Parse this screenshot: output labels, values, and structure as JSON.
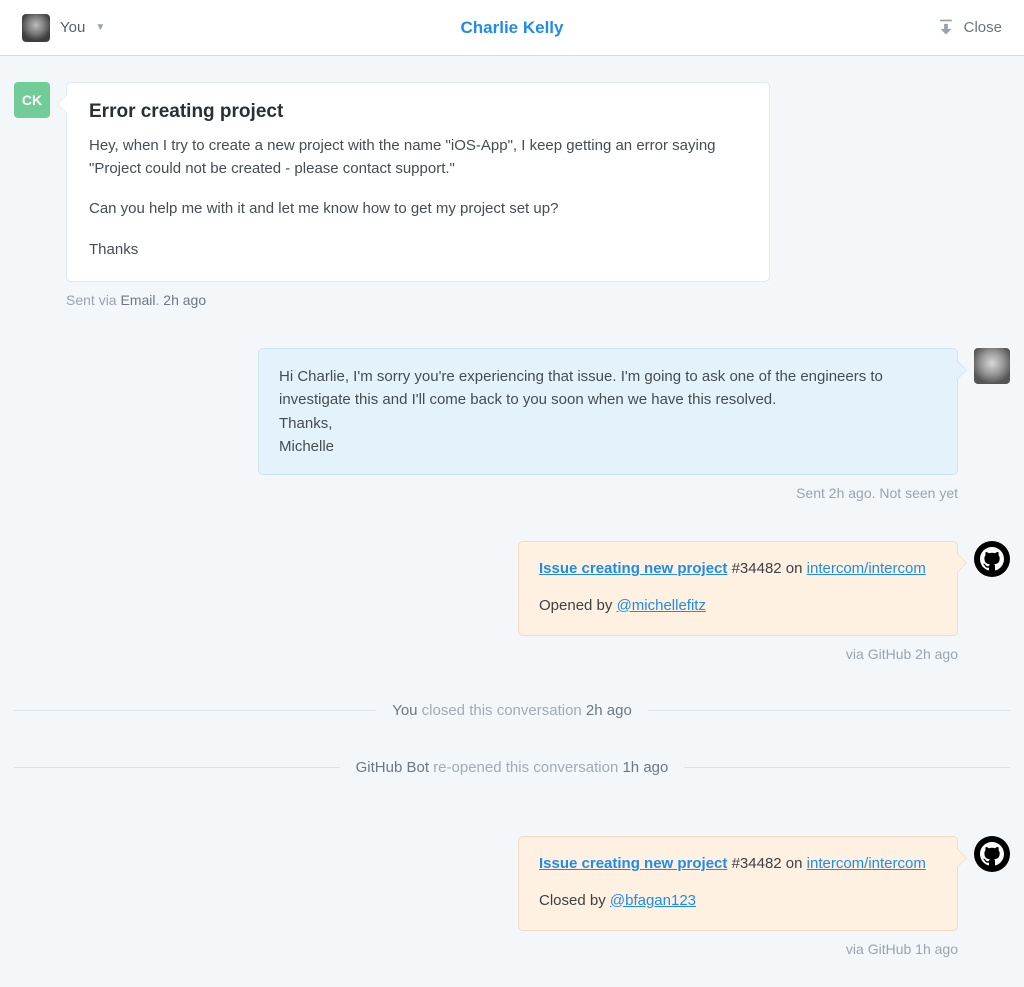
{
  "header": {
    "you_label": "You",
    "contact_name": "Charlie Kelly",
    "close_label": "Close"
  },
  "incoming": {
    "avatar_initials": "CK",
    "title": "Error creating project",
    "p1": "Hey, when I try to create a new project with the name \"iOS-App\", I keep getting an error saying \"Project could not be created - please contact support.\"",
    "p2": "Can you help me with it and let me know how to get my project set up?",
    "p3": "Thanks",
    "meta_prefix": "Sent via ",
    "meta_channel": "Email",
    "meta_sep": ". ",
    "meta_time": "2h ago"
  },
  "reply": {
    "line1": "Hi Charlie, I'm sorry you're experiencing that issue. I'm going to ask one of the engineers to investigate this and I'll come back to you soon when we have this resolved.",
    "line2": "Thanks,",
    "line3": "Michelle",
    "meta_sent": "Sent ",
    "meta_time": "2h ago",
    "meta_sep": ". ",
    "meta_seen": "Not seen yet"
  },
  "gh1": {
    "issue_title": "Issue creating new project",
    "issue_meta_number": " #34482 on ",
    "repo": "intercom/intercom",
    "action_prefix": "Opened by ",
    "actor": "@michellefitz",
    "via_prefix": "via ",
    "via_source": "GitHub",
    "via_time": " 2h ago"
  },
  "event1": {
    "who": "You",
    "what": " closed this conversation ",
    "when": "2h ago"
  },
  "event2": {
    "who": "GitHub Bot",
    "what": " re-opened this conversation ",
    "when": "1h ago"
  },
  "gh2": {
    "issue_title": "Issue creating new project",
    "issue_meta_number": " #34482 on ",
    "repo": "intercom/intercom",
    "action_prefix": "Closed by ",
    "actor": "@bfagan123",
    "via_prefix": "via ",
    "via_source": "GitHub",
    "via_time": " 1h ago"
  }
}
